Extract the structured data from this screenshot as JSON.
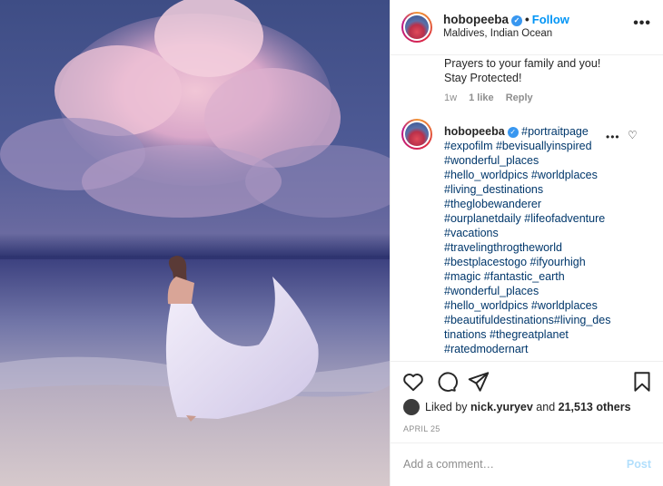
{
  "post": {
    "username": "hobopeeba",
    "location": "Maldives, Indian Ocean",
    "follow_label": "Follow",
    "separator": "•",
    "more_label": "•••"
  },
  "previous_comment": {
    "line1": "Prayers to your family and you!",
    "line2": "Stay Protected!",
    "time": "1w",
    "likes": "1 like",
    "reply": "Reply"
  },
  "caption": {
    "username": "hobopeeba",
    "lines": [
      "#portraitpage",
      "#expofilm #bevisuallyinspired",
      "#wonderful_places",
      "#hello_worldpics #worldplaces",
      "#living_destinations",
      "#theglobewanderer",
      "#ourplanetdaily #lifeofadventure",
      "#vacations",
      "#travelingthrogtheworld",
      "#bestplacestogo #ifyourhigh",
      "#magic #fantastic_earth",
      "#wonderful_places",
      "#hello_worldpics #worldplaces",
      "#beautifuldestinations#living_des",
      "tinations #thegreatplanet",
      "#ratedmodernart"
    ],
    "more_label": "•••"
  },
  "likes": {
    "prefix": "Liked by ",
    "user": "nick.yuryev",
    "middle": " and ",
    "count": "21,513 others"
  },
  "date": "APRIL 25",
  "comment_box": {
    "placeholder": "Add a comment…",
    "post_label": "Post"
  },
  "icons": [
    "verified-icon",
    "heart-icon",
    "comment-icon",
    "share-icon",
    "bookmark-icon",
    "more-icon"
  ],
  "colors": {
    "link": "#0095f6",
    "hashtag": "#00376b",
    "muted": "#8e8e8e",
    "verified": "#3897f0"
  }
}
